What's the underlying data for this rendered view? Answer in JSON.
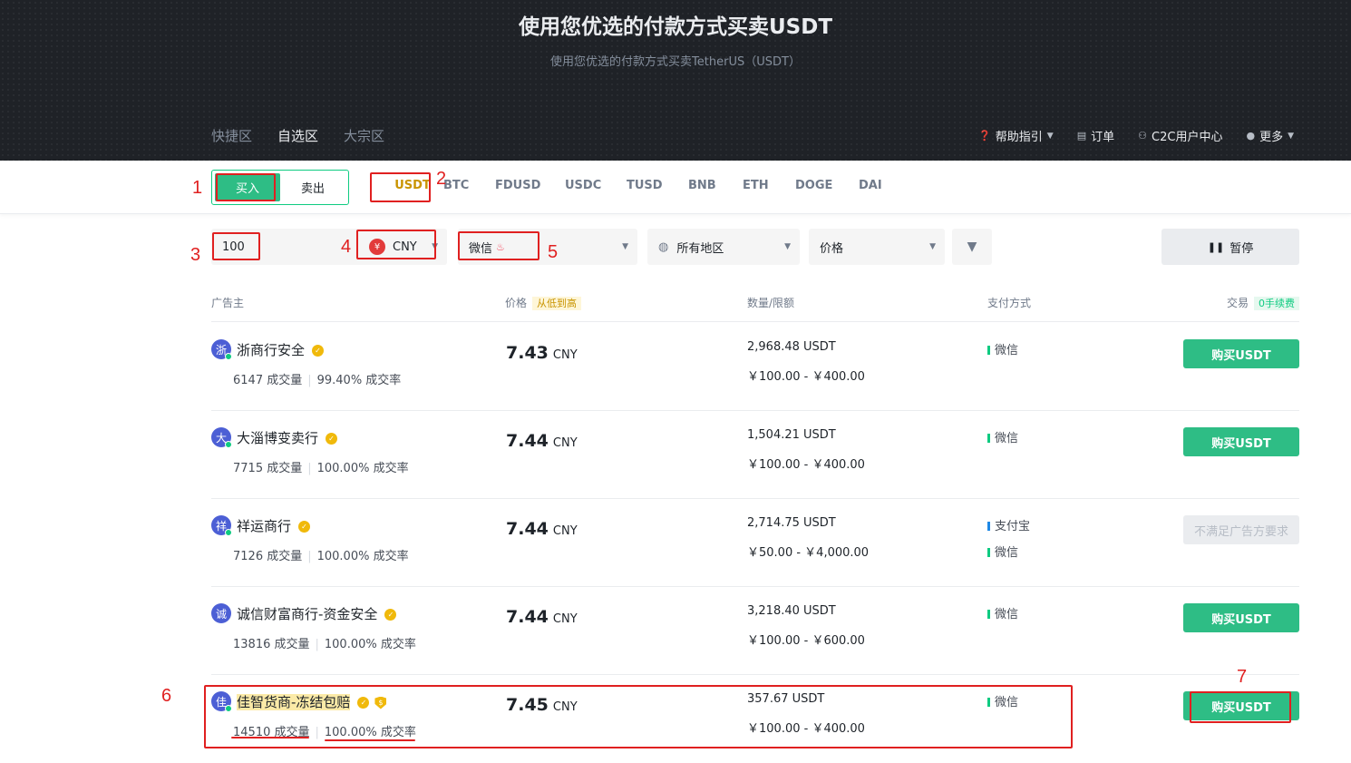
{
  "hero": {
    "title": "使用您优选的付款方式买卖USDT",
    "subtitle": "使用您优选的付款方式买卖TetherUS（USDT）"
  },
  "zone_tabs": [
    "快捷区",
    "自选区",
    "大宗区"
  ],
  "top_links": {
    "help": "帮助指引",
    "orders": "订单",
    "c2c_center": "C2C用户中心",
    "more": "更多"
  },
  "trade_side": {
    "buy": "买入",
    "sell": "卖出"
  },
  "coins": [
    "USDT",
    "BTC",
    "FDUSD",
    "USDC",
    "TUSD",
    "BNB",
    "ETH",
    "DOGE",
    "DAI"
  ],
  "filters": {
    "amount": "100",
    "currency_symbol": "¥",
    "currency": "CNY",
    "payment": "微信",
    "region": "所有地区",
    "sort": "价格",
    "pause": "暂停"
  },
  "table_headers": {
    "advertiser": "广告主",
    "price": "价格",
    "price_sort": "从低到高",
    "quantity": "数量/限额",
    "payment": "支付方式",
    "trade": "交易",
    "fee": "0手续费"
  },
  "ads": [
    {
      "avatar": "浙",
      "name": "浙商行安全",
      "orders": "6147 成交量",
      "rate": "99.40% 成交率",
      "price": "7.43",
      "unit": "CNY",
      "qty": "2,968.48 USDT",
      "limit": "￥100.00 - ￥400.00",
      "payments": [
        {
          "name": "微信",
          "color": "#0ecb81"
        }
      ],
      "action": "购买USDT"
    },
    {
      "avatar": "大",
      "name": "大淄博变卖行",
      "orders": "7715 成交量",
      "rate": "100.00% 成交率",
      "price": "7.44",
      "unit": "CNY",
      "qty": "1,504.21 USDT",
      "limit": "￥100.00 - ￥400.00",
      "payments": [
        {
          "name": "微信",
          "color": "#0ecb81"
        }
      ],
      "action": "购买USDT"
    },
    {
      "avatar": "祥",
      "name": "祥运商行",
      "orders": "7126 成交量",
      "rate": "100.00% 成交率",
      "price": "7.44",
      "unit": "CNY",
      "qty": "2,714.75 USDT",
      "limit": "￥50.00 - ￥4,000.00",
      "payments": [
        {
          "name": "支付宝",
          "color": "#1e88e5"
        },
        {
          "name": "微信",
          "color": "#0ecb81"
        }
      ],
      "action": "不满足广告方要求"
    },
    {
      "avatar": "诚",
      "name": "诚信财富商行-资金安全",
      "orders": "13816 成交量",
      "rate": "100.00% 成交率",
      "price": "7.44",
      "unit": "CNY",
      "qty": "3,218.40 USDT",
      "limit": "￥100.00 - ￥600.00",
      "payments": [
        {
          "name": "微信",
          "color": "#0ecb81"
        }
      ],
      "action": "购买USDT"
    },
    {
      "avatar": "佳",
      "name": "佳智货商-冻结包赔",
      "orders": "14510 成交量",
      "rate": "100.00% 成交率",
      "price": "7.45",
      "unit": "CNY",
      "qty": "357.67 USDT",
      "limit": "￥100.00 - ￥400.00",
      "payments": [
        {
          "name": "微信",
          "color": "#0ecb81"
        }
      ],
      "action": "购买USDT"
    }
  ],
  "annotations": [
    "1",
    "2",
    "3",
    "4",
    "5",
    "6",
    "7"
  ],
  "colors": {
    "accent_green": "#2ebd85",
    "accent_yellow": "#c99400",
    "annotation_red": "#e02020",
    "hero_bg": "#1f2227"
  }
}
